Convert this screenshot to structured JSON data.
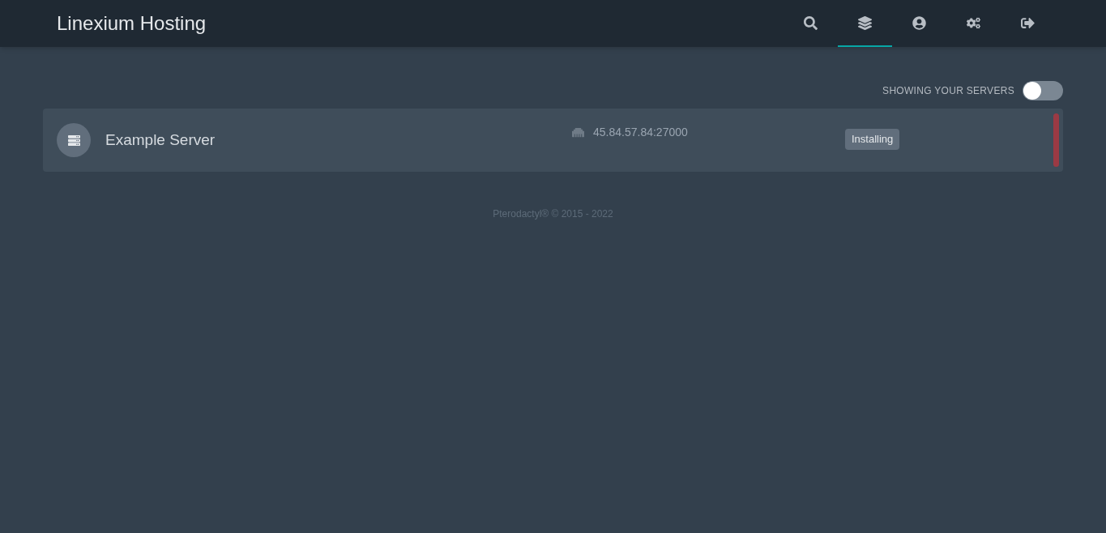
{
  "header": {
    "title": "Linexium Hosting"
  },
  "nav": [
    {
      "kind": "search",
      "selected": false
    },
    {
      "kind": "servers",
      "selected": true
    },
    {
      "kind": "account",
      "selected": false
    },
    {
      "kind": "admin",
      "selected": false
    },
    {
      "kind": "logout",
      "selected": false
    }
  ],
  "filter": {
    "label": "SHOWING YOUR SERVERS",
    "on": false
  },
  "servers": [
    {
      "name": "Example Server",
      "address": "45.84.57.84:27000",
      "status": "Installing",
      "color": "#9b3a44"
    }
  ],
  "footer": "Pterodactyl® © 2015 - 2022"
}
